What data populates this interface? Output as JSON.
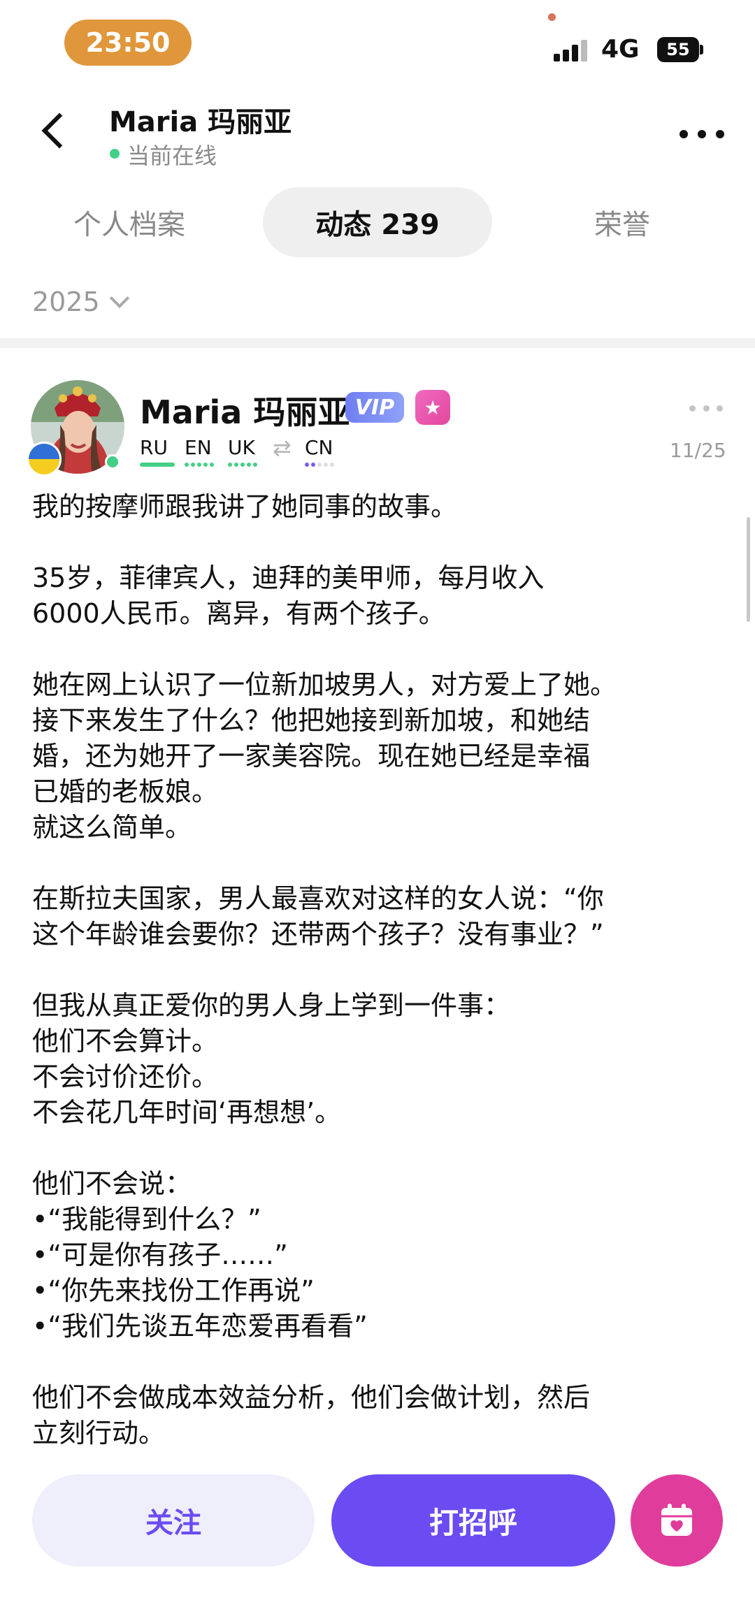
{
  "status_bar": {
    "time": "23:50",
    "network": "4G",
    "battery": "55",
    "time_pill_color": "#e0963a"
  },
  "header": {
    "name": "Maria 玛丽亚",
    "status": "当前在线",
    "online_color": "#44cf86"
  },
  "tabs": [
    {
      "label": "个人档案",
      "active": false
    },
    {
      "label": "动态 239",
      "active": true
    },
    {
      "label": "荣誉",
      "active": false
    }
  ],
  "filter": {
    "year": "2025"
  },
  "post": {
    "author": "Maria 玛丽亚",
    "vip_label": "VIP",
    "languages": [
      {
        "code": "RU",
        "level": 1.0,
        "color": "#44cf86"
      },
      {
        "code": "EN",
        "level": 1.0,
        "color": "#44cf86"
      },
      {
        "code": "UK",
        "level": 1.0,
        "color": "#44cf86"
      },
      {
        "code": "CN",
        "level": 0.4,
        "color": "#7b5cf5"
      }
    ],
    "date": "11/25",
    "lines": [
      "我的按摩师跟我讲了她同事的故事。",
      "",
      "35岁，菲律宾人，迪拜的美甲师，每月收入",
      "6000人民币。离异，有两个孩子。",
      "",
      "她在网上认识了一位新加坡男人，对方爱上了她。",
      "接下来发生了什么？他把她接到新加坡，和她结",
      "婚，还为她开了一家美容院。现在她已经是幸福",
      "已婚的老板娘。",
      "就这么简单。",
      "",
      "在斯拉夫国家，男人最喜欢对这样的女人说：“你",
      "这个年龄谁会要你？还带两个孩子？没有事业？”",
      "",
      "但我从真正爱你的男人身上学到一件事：",
      "他们不会算计。",
      "不会讨价还价。",
      "不会花几年时间‘再想想’。",
      "",
      "他们不会说：",
      "•“我能得到什么？”",
      "•“可是你有孩子……”",
      "•“你先来找份工作再说”",
      "•“我们先谈五年恋爱再看看”",
      "",
      "他们不会做成本效益分析，他们会做计划，然后",
      "立刻行动。"
    ]
  },
  "actions": {
    "follow": "关注",
    "greet": "打招呼",
    "primary_color": "#6b4bf2",
    "calendar_color": "#e03c9b"
  }
}
